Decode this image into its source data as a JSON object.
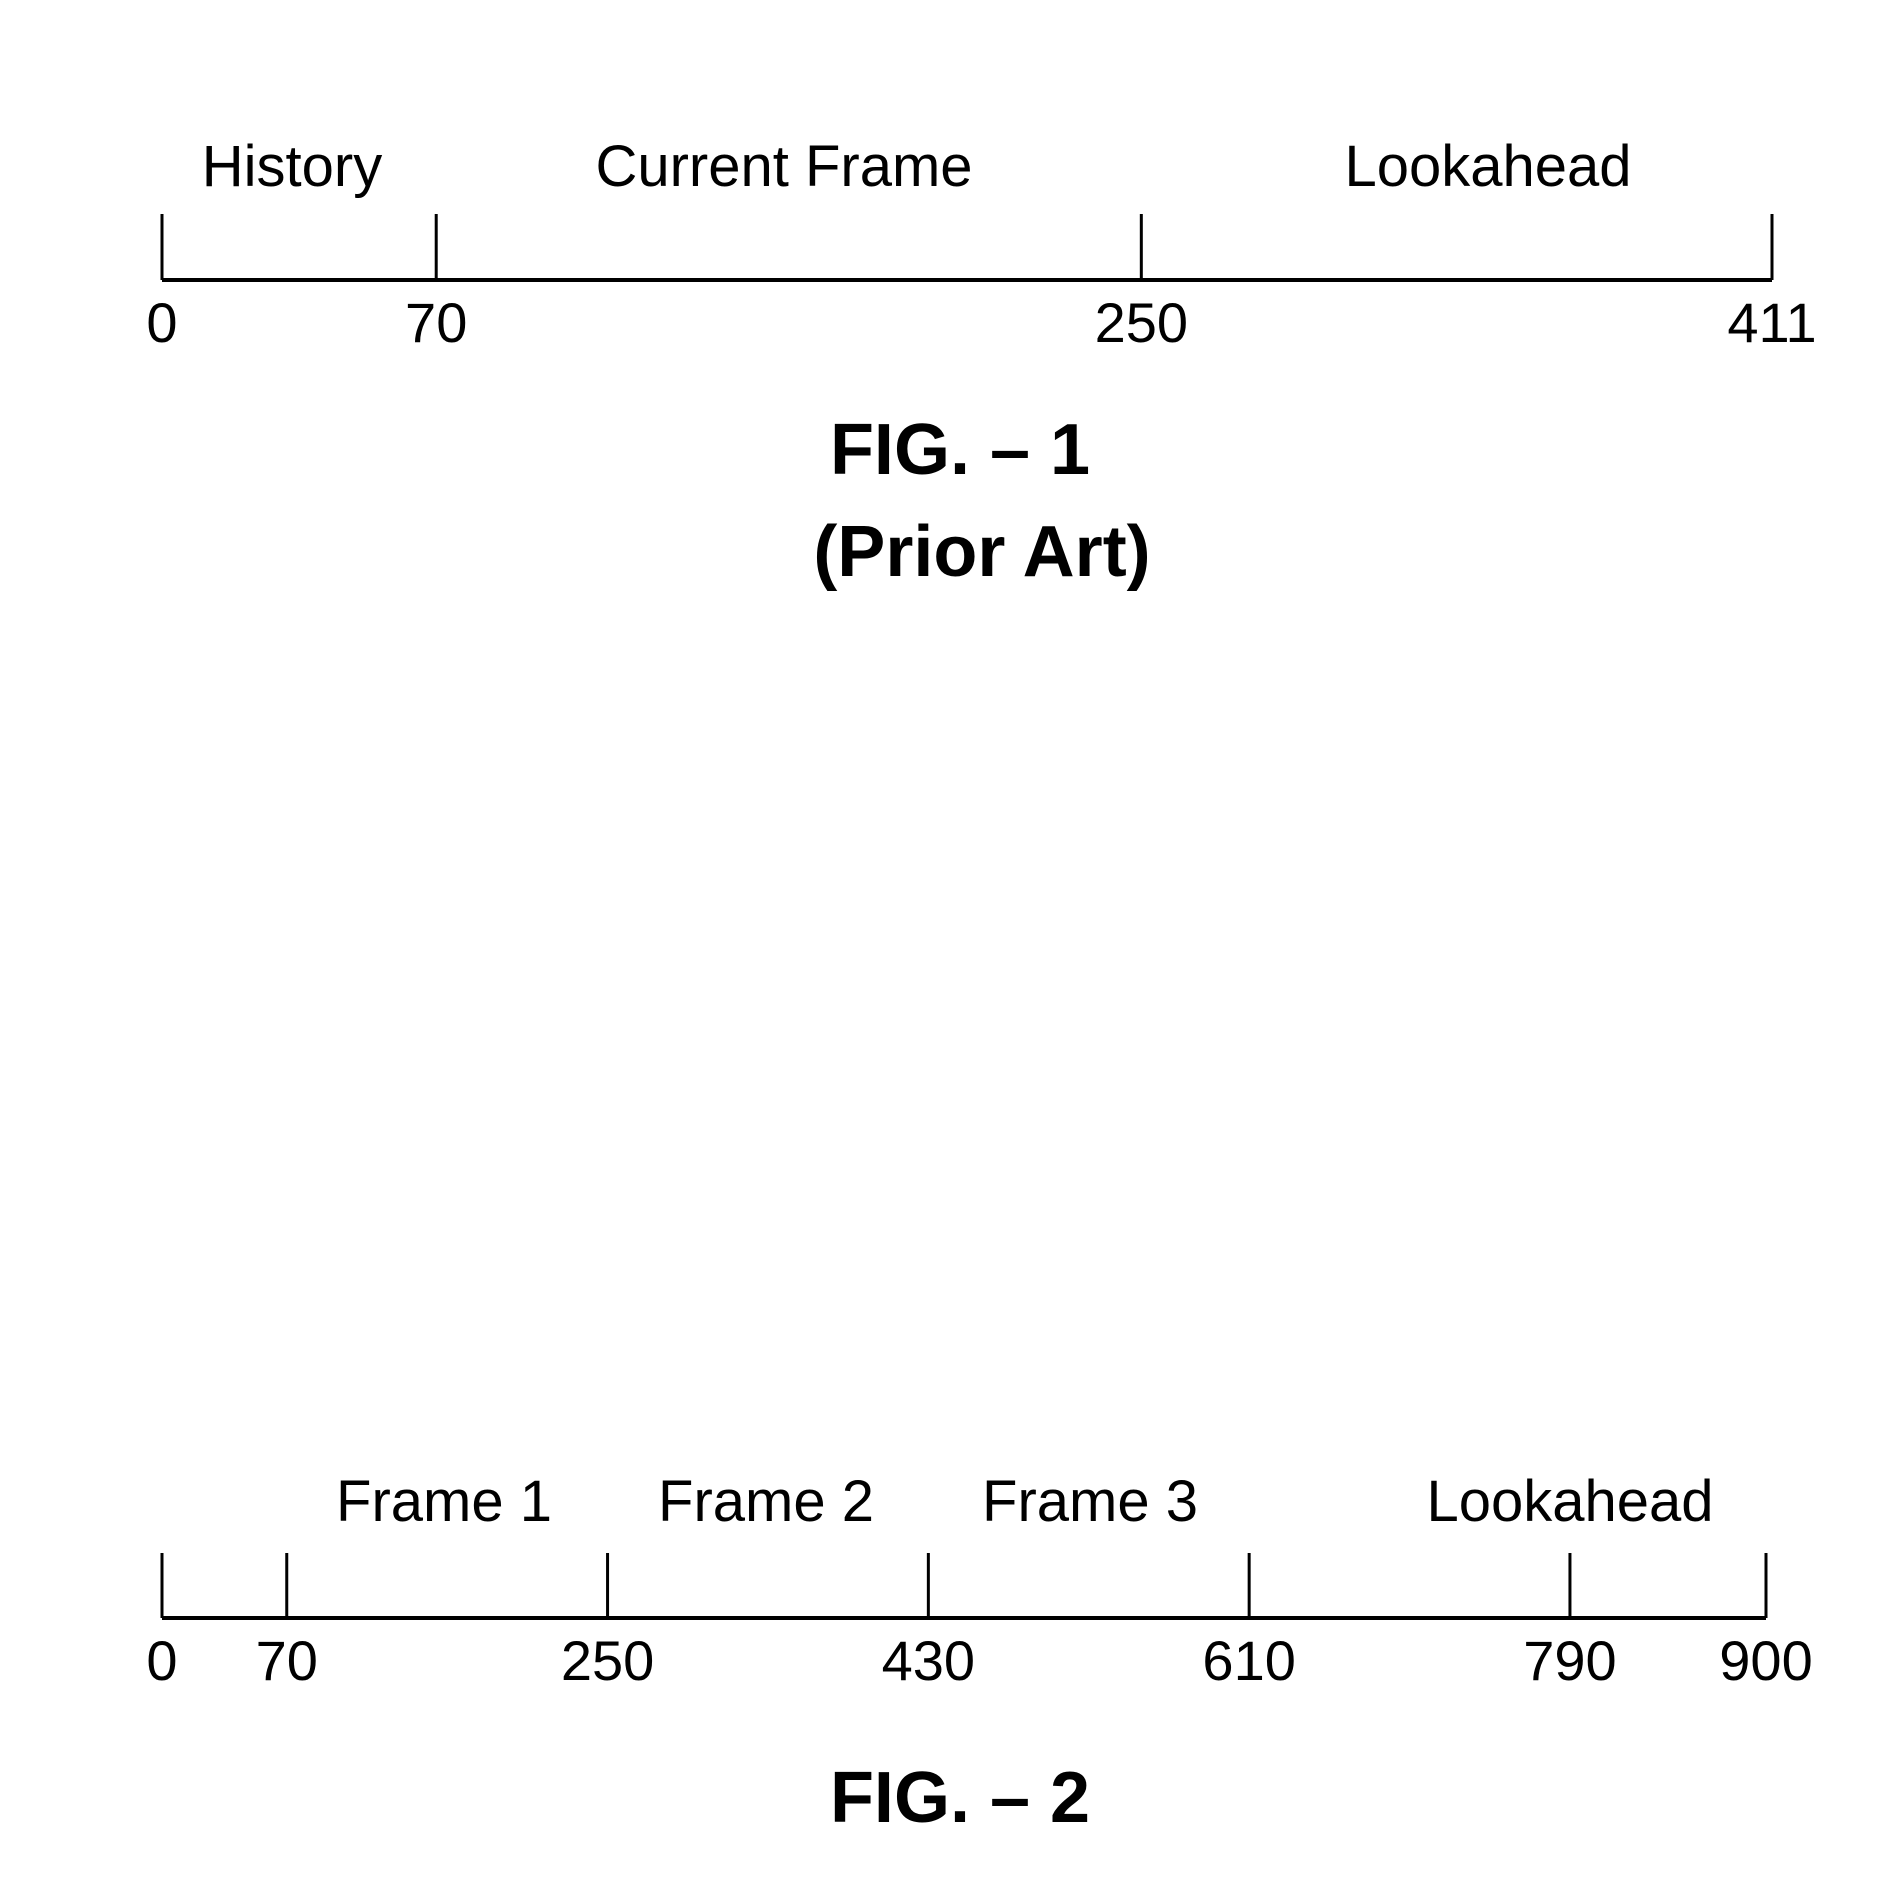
{
  "figures": [
    {
      "id": "fig1",
      "caption": "FIG. – 1",
      "subcaption": "(Prior Art)",
      "axis_range": [
        0,
        411
      ],
      "ticks": [
        0,
        70,
        250,
        411
      ],
      "tick_labels": [
        "0",
        "70",
        "250",
        "411"
      ],
      "segments": [
        {
          "label": "History",
          "start": 0,
          "end": 70
        },
        {
          "label": "Current Frame",
          "start": 70,
          "end": 250
        },
        {
          "label": "Lookahead",
          "start": 250,
          "end": 411
        }
      ]
    },
    {
      "id": "fig2",
      "caption": "FIG. – 2",
      "subcaption": "",
      "axis_range": [
        0,
        900
      ],
      "ticks": [
        0,
        70,
        250,
        430,
        610,
        790,
        900
      ],
      "tick_labels": [
        "0",
        "70",
        "250",
        "430",
        "610",
        "790",
        "900"
      ],
      "segments": [
        {
          "label": "Frame 1",
          "start": 70,
          "end": 250
        },
        {
          "label": "Frame 2",
          "start": 250,
          "end": 430
        },
        {
          "label": "Frame 3",
          "start": 430,
          "end": 610
        },
        {
          "label": "Lookahead",
          "start": 610,
          "end": 900
        }
      ]
    }
  ]
}
